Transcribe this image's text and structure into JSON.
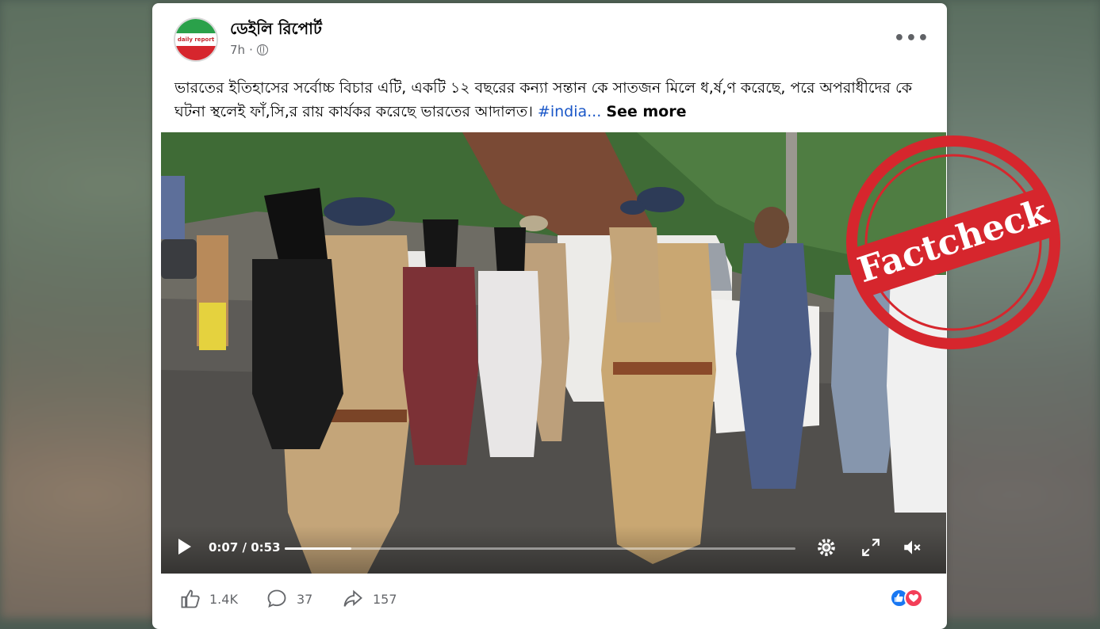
{
  "page": {
    "name": "ডেইলি রিপোর্ট",
    "avatar_text": "daily report",
    "time": "7h",
    "audience_icon": "globe-icon",
    "more_icon": "more-options-icon"
  },
  "post": {
    "text": "ভারতের ইতিহাসের সর্বোচ্চ বিচার এটি, একটি ১২ বছরের কন্যা সন্তান কে সাতজন মিলে ধ,র্ষ,ণ করেছে, পরে অপরাধীদের কে ঘটনা স্থলেই ফাঁ,সি,র রায় কার্যকর করেছে ভারতের আদালত। ",
    "hashtag": "#india...",
    "see_more": "See more"
  },
  "video": {
    "time_display": "0:07 / 0:53",
    "progress_fraction": 0.13,
    "play_icon": "play-icon",
    "settings_icon": "gear-icon",
    "fullscreen_icon": "fullscreen-icon",
    "mute_icon": "volume-muted-icon"
  },
  "stats": {
    "likes": "1.4K",
    "comments": "37",
    "shares": "157"
  },
  "stamp": {
    "text": "Factcheck",
    "color": "#d6262d"
  }
}
